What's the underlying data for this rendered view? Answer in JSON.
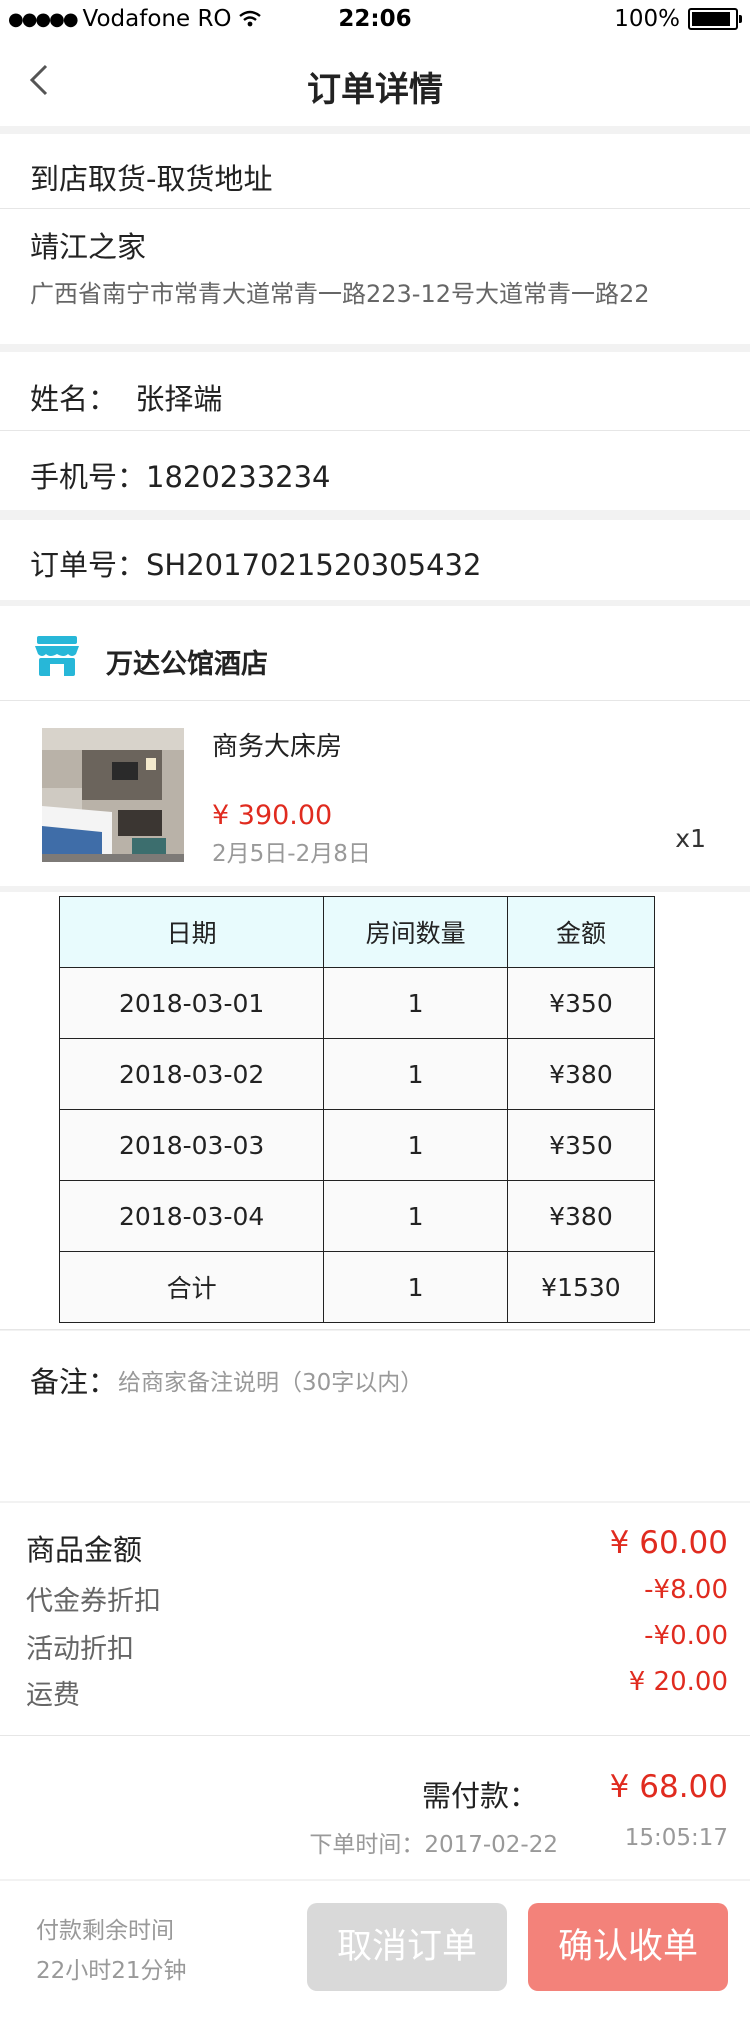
{
  "status_bar": {
    "carrier": "Vodafone RO",
    "time": "22:06",
    "battery": "100%"
  },
  "header": {
    "title": "订单详情"
  },
  "pickup": {
    "label": "到店取货-取货地址",
    "store_name": "靖江之家",
    "address": "广西省南宁市常青大道常青一路223-12号大道常青一路22"
  },
  "contact": {
    "name": "姓名：  张择端",
    "phone": "手机号：1820233234"
  },
  "order": {
    "number": "订单号：SH2017021520305432"
  },
  "shop": {
    "name": "万达公馆酒店",
    "icon": "store-icon"
  },
  "product": {
    "name": "商务大床房",
    "price": "¥ 390.00",
    "dates": "2月5日-2月8日",
    "quantity": "x1"
  },
  "table": {
    "headers": [
      "日期",
      "房间数量",
      "金额"
    ],
    "rows": [
      [
        "2018-03-01",
        "1",
        "¥350"
      ],
      [
        "2018-03-02",
        "1",
        "¥380"
      ],
      [
        "2018-03-03",
        "1",
        "¥350"
      ],
      [
        "2018-03-04",
        "1",
        "¥380"
      ],
      [
        "合计",
        "1",
        "¥1530"
      ]
    ]
  },
  "remark": {
    "label": "备注：",
    "placeholder": "给商家备注说明（30字以内）"
  },
  "summary": {
    "goods_label": "商品金额",
    "goods_value": "¥ 60.00",
    "coupon_label": "代金券折扣",
    "coupon_value": "-¥8.00",
    "activity_label": "活动折扣",
    "activity_value": "-¥0.00",
    "shipping_label": "运费",
    "shipping_value": "¥ 20.00",
    "pay_label": "需付款：",
    "pay_value": "¥ 68.00",
    "order_time_label": "下单时间：2017-02-22",
    "order_time_clock": "15:05:17"
  },
  "footer": {
    "remaining_label": "付款剩余时间",
    "remaining_value": "22小时21分钟",
    "cancel_label": "取消订单",
    "confirm_label": "确认收单",
    "cancel_color": "#d9d9d9",
    "confirm_color": "#f3827a"
  },
  "colors": {
    "accent_red": "#e02b1f",
    "table_header_bg": "#e8fbfd",
    "store_icon": "#27b7d8"
  }
}
